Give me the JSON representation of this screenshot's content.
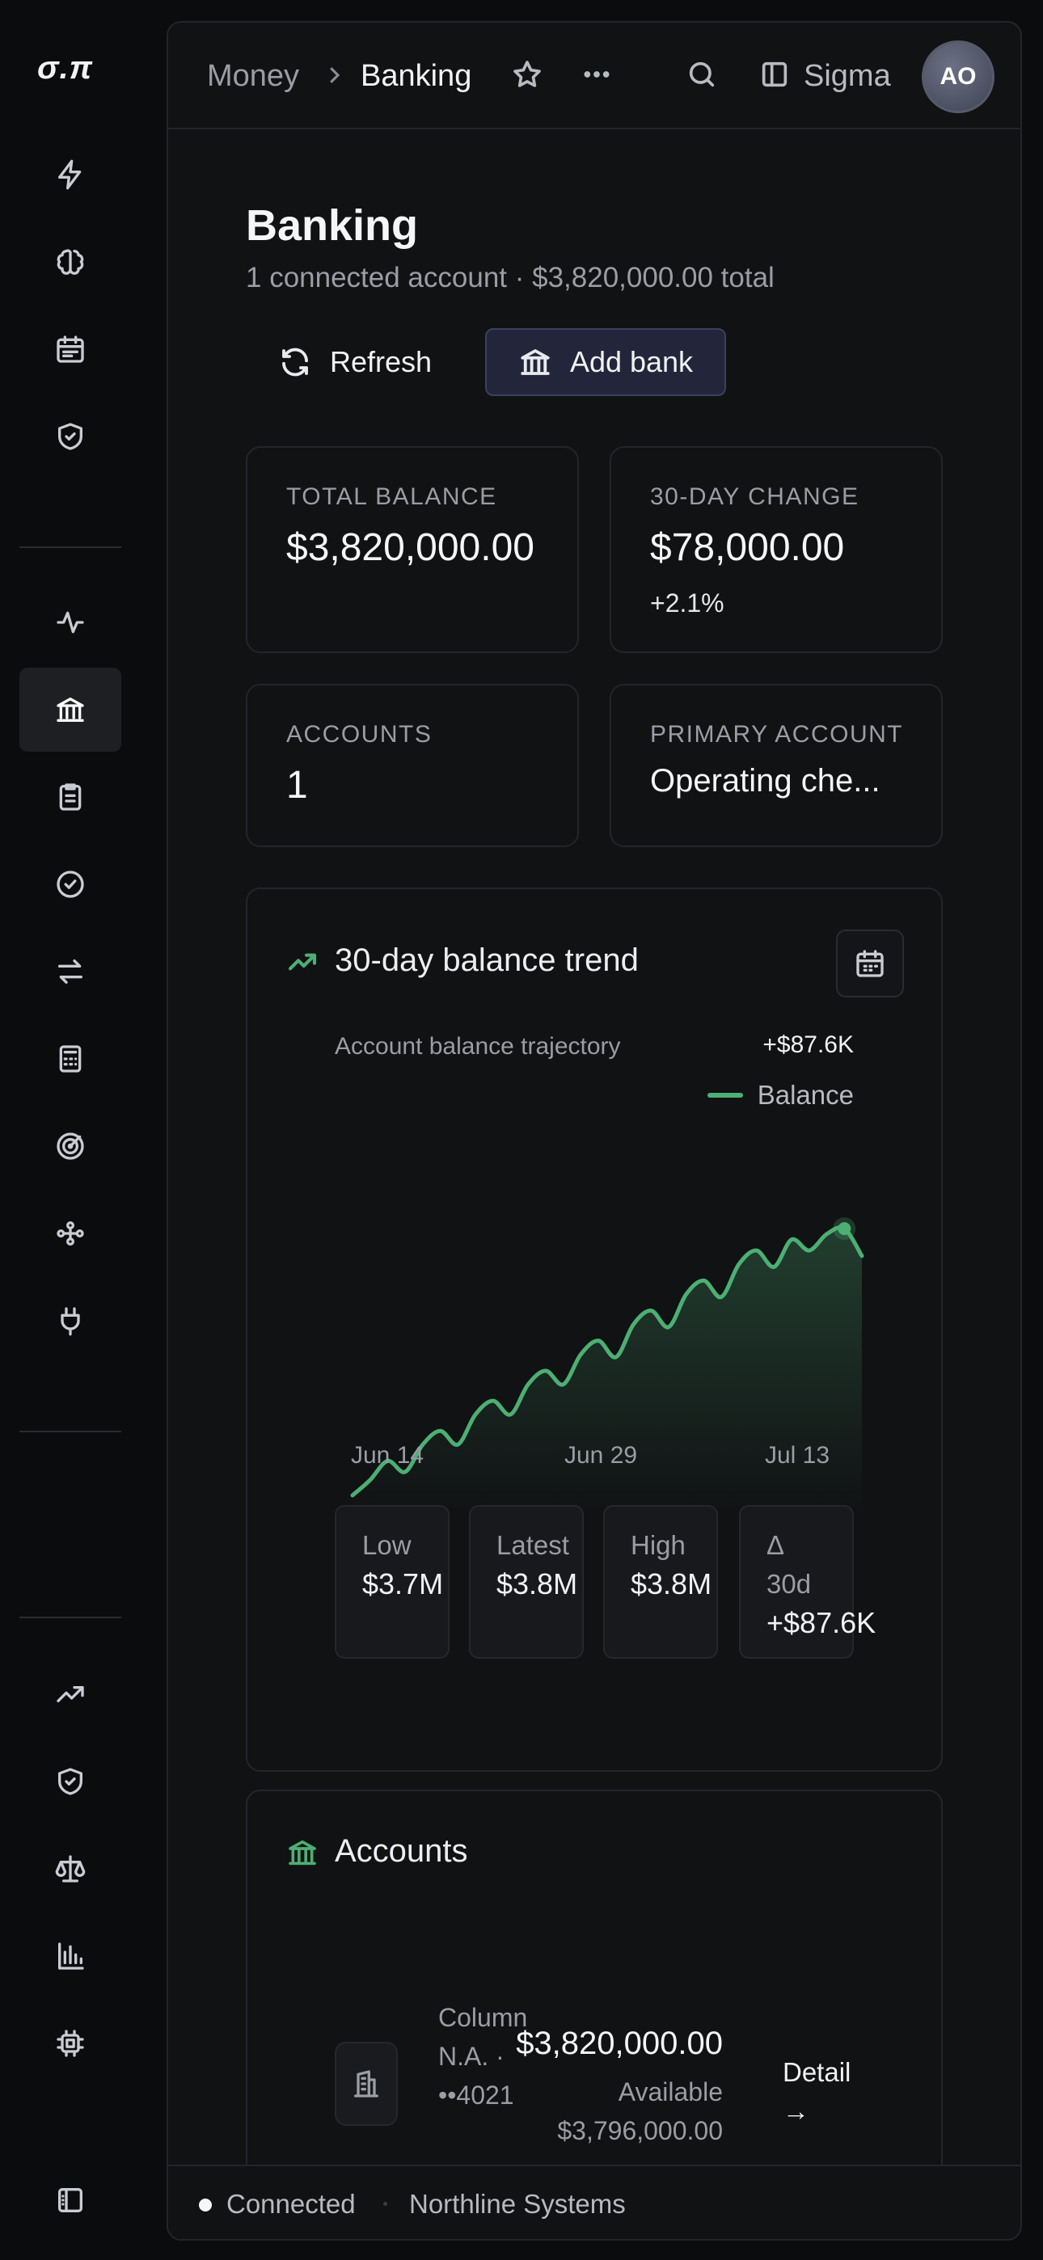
{
  "app": {
    "logo": "σ.π"
  },
  "sidebar": {
    "top_icons": [
      "bolt-icon",
      "brain-icon",
      "calendar-icon",
      "shield-check-icon"
    ],
    "mid_icons": [
      "activity-icon",
      "bank-icon",
      "clipboard-icon",
      "badge-check-icon",
      "arrows-swap-icon",
      "calculator-icon",
      "target-icon",
      "workflow-icon",
      "plug-icon"
    ],
    "bottom_icons": [
      "trending-up-icon",
      "shield-check-icon",
      "scale-icon",
      "bar-chart-icon",
      "cpu-icon"
    ],
    "collapse_icon": "sidebar-toggle-icon",
    "active_item": "bank-icon"
  },
  "header": {
    "breadcrumb": [
      "Money",
      "Banking"
    ],
    "workspace": "Sigma",
    "avatar_initials": "AO"
  },
  "page": {
    "title": "Banking",
    "subtitle": "1 connected account · $3,820,000.00 total",
    "refresh_label": "Refresh",
    "add_bank_label": "Add bank"
  },
  "stats": {
    "total_balance_label": "TOTAL BALANCE",
    "total_balance_value": "$3,820,000.00",
    "change_label": "30-DAY CHANGE",
    "change_value": "$78,000.00",
    "change_pct": "+2.1%",
    "accounts_label": "ACCOUNTS",
    "accounts_value": "1",
    "primary_label": "PRIMARY ACCOUNT",
    "primary_value": "Operating che..."
  },
  "trend": {
    "title": "30-day balance trend",
    "subtitle": "Account balance trajectory",
    "delta": "+$87.6K",
    "legend": "Balance",
    "stats": [
      {
        "label": "Low",
        "value": "$3.7M"
      },
      {
        "label": "Latest",
        "value": "$3.8M"
      },
      {
        "label": "High",
        "value": "$3.8M"
      },
      {
        "label": "Δ 30d",
        "value": "+$87.6K"
      }
    ]
  },
  "chart_data": {
    "type": "area",
    "title": "30-day balance trend",
    "subtitle": "Account balance trajectory",
    "series": [
      {
        "name": "Balance",
        "color": "#4caf73",
        "x": [
          "Jun 14",
          "Jun 15",
          "Jun 16",
          "Jun 17",
          "Jun 18",
          "Jun 19",
          "Jun 20",
          "Jun 21",
          "Jun 22",
          "Jun 23",
          "Jun 24",
          "Jun 25",
          "Jun 26",
          "Jun 27",
          "Jun 28",
          "Jun 29",
          "Jun 30",
          "Jul 1",
          "Jul 2",
          "Jul 3",
          "Jul 4",
          "Jul 5",
          "Jul 6",
          "Jul 7",
          "Jul 8",
          "Jul 9",
          "Jul 10",
          "Jul 11",
          "Jul 12",
          "Jul 13"
        ],
        "values": [
          3732400,
          3738000,
          3745000,
          3741000,
          3751000,
          3756000,
          3751000,
          3762000,
          3767000,
          3762000,
          3773000,
          3778000,
          3773000,
          3784000,
          3789000,
          3783000,
          3795000,
          3800000,
          3794000,
          3806000,
          3811000,
          3805000,
          3817000,
          3822000,
          3816000,
          3826000,
          3822000,
          3828000,
          3830000,
          3820000
        ]
      }
    ],
    "xticks": [
      "Jun 14",
      "Jun 29",
      "Jul 13"
    ],
    "grid": false,
    "legend_position": "top-right"
  },
  "accounts": {
    "title": "Accounts",
    "items": [
      {
        "name": "Column N.A. · ••4021",
        "balance": "$3,820,000.00",
        "available_label": "Available",
        "available_value": "$3,796,000.00",
        "detail_label": "Detail →"
      }
    ]
  },
  "footer": {
    "status": "Connected",
    "org": "Northline Systems"
  }
}
